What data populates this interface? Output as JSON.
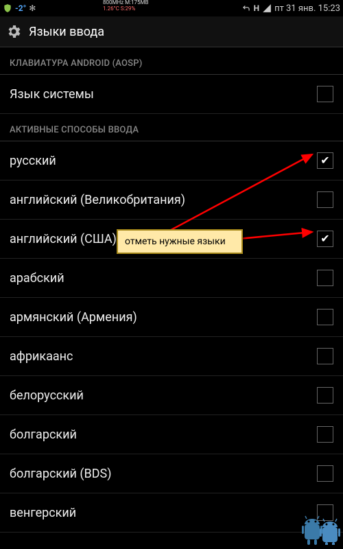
{
  "statusbar": {
    "left_icons": [
      "shield-icon",
      "temp-icon",
      "snowflake-icon"
    ],
    "temp_text": "-2°",
    "mid_line1": "800MHz M:175MB",
    "mid_line2": "1.26°C S:29%",
    "right_icons": [
      "uturn-icon",
      "signal-icon"
    ],
    "clock_text": "пт 31 янв. 15:23"
  },
  "titlebar": {
    "title": "Языки ввода"
  },
  "sections": {
    "keyboard_header": "КЛАВИАТУРА ANDROID (AOSP)",
    "system_lang_label": "Язык системы",
    "active_header": "АКТИВНЫЕ СПОСОБЫ ВВОДА"
  },
  "languages": [
    {
      "label": "русский",
      "checked": true
    },
    {
      "label": "английский (Великобритания)",
      "checked": false
    },
    {
      "label": "английский (США)",
      "checked": true
    },
    {
      "label": "арабский",
      "checked": false
    },
    {
      "label": "армянский (Армения)",
      "checked": false
    },
    {
      "label": "африкаанс",
      "checked": false
    },
    {
      "label": "белорусский",
      "checked": false
    },
    {
      "label": "болгарский",
      "checked": false
    },
    {
      "label": "болгарский (BDS)",
      "checked": false
    },
    {
      "label": "венгерский",
      "checked": false
    }
  ],
  "annotation": {
    "text": "отметь нужные языки"
  },
  "colors": {
    "accent_arrow": "#ff0000",
    "callout_bg": "#ffe9a8",
    "callout_border": "#a88a1a"
  }
}
